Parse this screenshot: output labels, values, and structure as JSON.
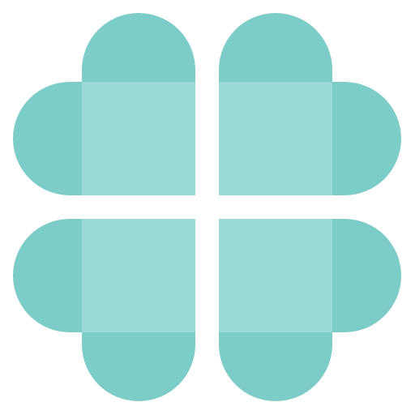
{
  "icon": {
    "name": "four-leaf-clover-icon",
    "colors": {
      "background": "#ffffff",
      "lobe": "#7ccdc8",
      "center": "#99d9d6"
    }
  }
}
